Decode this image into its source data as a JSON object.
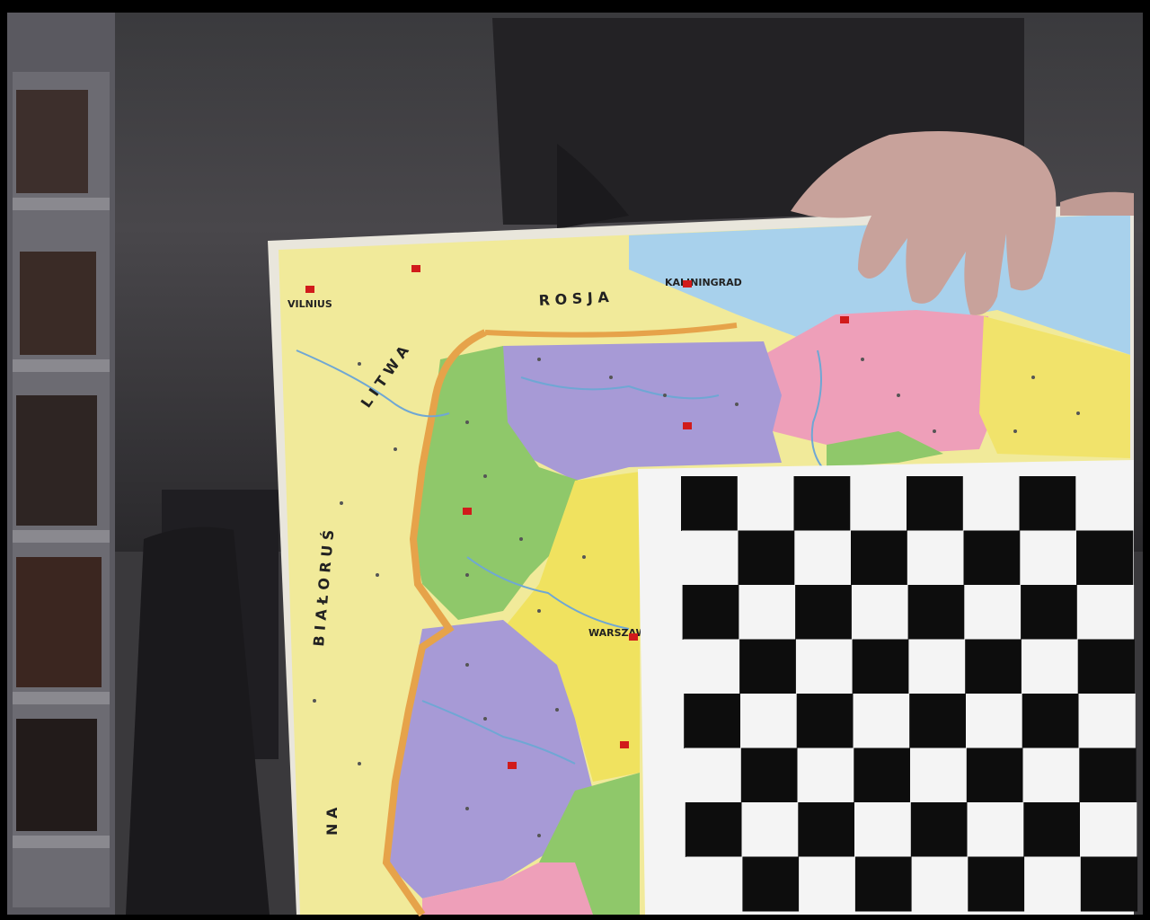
{
  "photo": {
    "subject": "person holding a map board with a calibration checkerboard",
    "checkerboard": {
      "cols": 8,
      "rows": 8
    }
  },
  "map": {
    "country_labels": {
      "rosja": "R O S J A",
      "litwa": "L I T W A",
      "bialorus": "B I A Ł O R U Ś",
      "ukraina": "N A"
    },
    "cities": {
      "vilnius": "VILNIUS",
      "kaliningrad": "KALININGRAD",
      "warszawa": "WARSZAWA"
    }
  },
  "colors": {
    "background": "#2a2a2e",
    "wall": "#3a393c",
    "map_yellow": "#f1ea9a",
    "map_green": "#8fc86a",
    "map_purple": "#a79ad6",
    "map_pink": "#ee9fb9",
    "map_lake": "#a8d1ec",
    "border_orange": "#e6a34a",
    "checker_black": "#0d0d0d",
    "checker_white": "#f4f4f4"
  }
}
